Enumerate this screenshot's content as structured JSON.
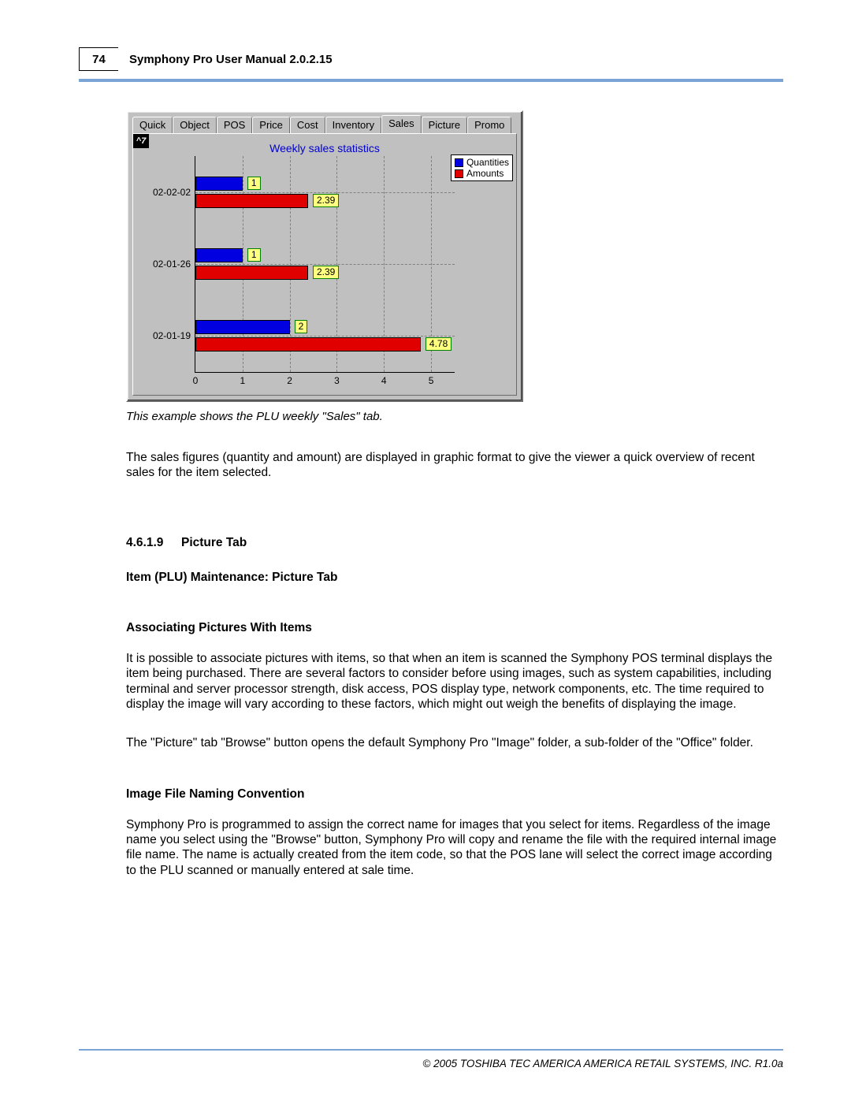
{
  "header": {
    "page_number": "74",
    "title": "Symphony Pro User Manual  2.0.2.15"
  },
  "screenshot": {
    "tabs": [
      "Quick",
      "Object",
      "POS",
      "Price",
      "Cost",
      "Inventory",
      "Sales",
      "Picture",
      "Promo"
    ],
    "active_tab_index": 6,
    "logo": "^7",
    "chart_title": "Weekly sales statistics",
    "legend": {
      "0": "Quantities",
      "1": "Amounts"
    }
  },
  "chart_data": {
    "type": "bar",
    "orientation": "horizontal",
    "grouped": true,
    "title": "Weekly sales statistics",
    "xlabel": "",
    "ylabel": "",
    "xlim": [
      0,
      5.5
    ],
    "xticks": [
      0,
      1,
      2,
      3,
      4,
      5
    ],
    "categories": [
      "02-02-02",
      "02-01-26",
      "02-01-19"
    ],
    "series": [
      {
        "name": "Quantities",
        "color": "#0000e0",
        "values": [
          1,
          1,
          2
        ]
      },
      {
        "name": "Amounts",
        "color": "#e00000",
        "values": [
          2.39,
          2.39,
          4.78
        ]
      }
    ],
    "data_labels": {
      "Quantities": [
        "1",
        "1",
        "2"
      ],
      "Amounts": [
        "2.39",
        "2.39",
        "4.78"
      ]
    }
  },
  "caption": "This example shows the PLU weekly \"Sales\" tab.",
  "paragraph_after_figure": " The sales figures (quantity and amount) are displayed in graphic format to give the viewer a quick overview of recent sales for the item selected.",
  "section": {
    "number": "4.6.1.9",
    "title": "Picture Tab"
  },
  "sub1": "Item (PLU) Maintenance: Picture Tab",
  "sub2": "Associating Pictures With Items",
  "para_assoc1": " It is possible to associate pictures with items, so that when an item is scanned the Symphony POS terminal displays the item being purchased. There are several factors to consider before using images, such as system capabilities, including terminal and server processor strength, disk access, POS display type, network components, etc. The time required to display the image will vary according to these factors, which might out weigh the benefits of displaying the image.",
  "para_assoc2": " The \"Picture\" tab \"Browse\" button opens the default Symphony Pro \"Image\" folder, a sub-folder of the \"Office\" folder.",
  "sub3": "Image File Naming Convention",
  "para_naming": " Symphony Pro is programmed to assign the correct name for images that you select for items. Regardless of the image name you select using the \"Browse\" button, Symphony Pro will copy and rename the file with the required internal image file name. The name is actually created from the item code, so that the POS lane will select the correct image according to the PLU scanned or manually entered at sale time.",
  "footer": "© 2005 TOSHIBA TEC AMERICA AMERICA RETAIL SYSTEMS, INC.   R1.0a"
}
